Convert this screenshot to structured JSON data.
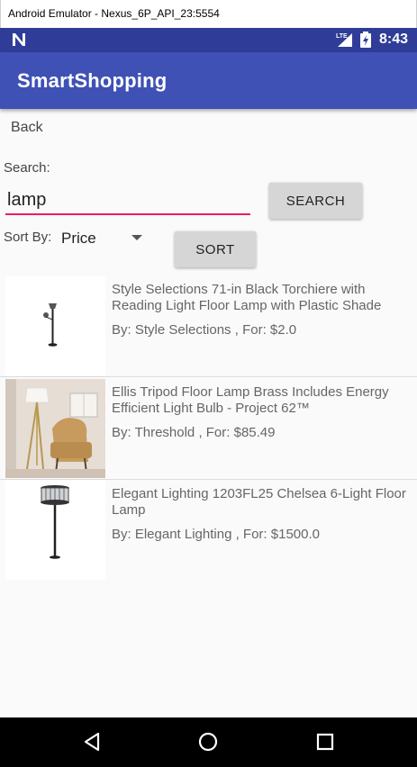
{
  "window": {
    "title": "Android Emulator - Nexus_6P_API_23:5554"
  },
  "status_bar": {
    "time": "8:43",
    "network": "LTE"
  },
  "app_bar": {
    "title": "SmartShopping"
  },
  "back": {
    "label": "Back"
  },
  "search": {
    "label": "Search:",
    "value": "lamp",
    "button_label": "SEARCH"
  },
  "sort": {
    "label": "Sort By:",
    "selected": "Price",
    "button_label": "SORT"
  },
  "results": [
    {
      "name": "Style Selections 71-in Black Torchiere with Reading Light Floor Lamp with Plastic Shade",
      "meta": "By: Style Selections , For: $2.0"
    },
    {
      "name": "Ellis Tripod Floor Lamp Brass Includes Energy Efficient Light Bulb - Project 62™",
      "meta": "By: Threshold , For: $85.49"
    },
    {
      "name": "Elegant Lighting 1203FL25 Chelsea 6-Light Floor Lamp",
      "meta": "By: Elegant Lighting , For: $1500.0"
    }
  ],
  "colors": {
    "app_bar": "#3f51b5",
    "status_bar": "#2f3d99",
    "accent": "#e91e63"
  }
}
